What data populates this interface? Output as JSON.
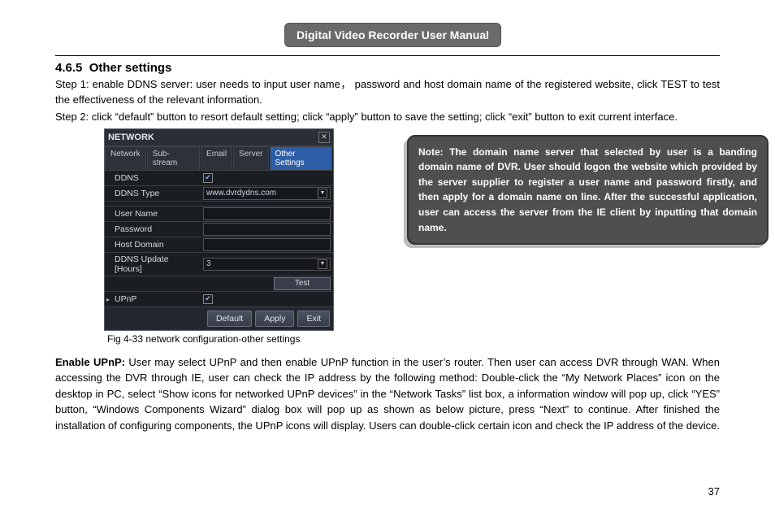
{
  "header": {
    "title": "Digital Video Recorder User Manual"
  },
  "section": {
    "number": "4.6.5",
    "title": "Other settings"
  },
  "steps": {
    "step1": "Step 1: enable DDNS server: user needs to input user name， password and host domain name of the registered website, click TEST to test the effectiveness of the relevant information.",
    "step2": "Step 2: click “default” button to resort default setting; click “apply” button to save the setting; click “exit” button to exit current interface."
  },
  "dvr": {
    "title": "NETWORK",
    "close": "✕",
    "tabs": [
      "Network",
      "Sub-stream",
      "Email",
      "Server",
      "Other Settings"
    ],
    "rows": {
      "ddns": "DDNS",
      "ddns_type": "DDNS Type",
      "ddns_type_val": "www.dvrdydns.com",
      "user_name": "User Name",
      "password": "Password",
      "host_domain": "Host Domain",
      "ddns_update": "DDNS Update [Hours]",
      "ddns_update_val": "3",
      "test": "Test",
      "upnp": "UPnP"
    },
    "footer": {
      "default": "Default",
      "apply": "Apply",
      "exit": "Exit"
    }
  },
  "caption": "Fig 4-33 network configuration-other settings",
  "note": "Note: The domain name server that selected by user is a banding domain name of DVR. User should logon the website which provided by the server supplier to register a user name and password firstly, and then apply for a domain name on line. After the successful application, user can access the server from the IE client by inputting that domain name.",
  "upnp_heading": "Enable UPnP:",
  "upnp_body": " User may select UPnP and then enable UPnP function in the user’s router. Then user can access DVR through WAN. When accessing the DVR through IE, user can check the IP address by the following method: Double-click the “My Network Places” icon on the desktop in PC, select “Show icons for networked UPnP devices” in the “Network Tasks” list box, a information window will pop up, click “YES” button, “Windows Components Wizard” dialog box will pop up as shown as below picture, press “Next” to continue. After finished the installation of configuring components, the UPnP icons will display. Users can double-click certain icon and check the IP address of the device.",
  "page": "37"
}
